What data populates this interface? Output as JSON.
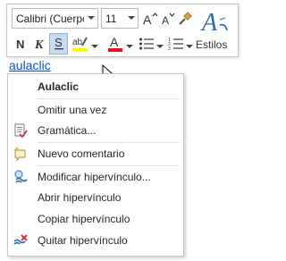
{
  "mini_toolbar": {
    "font_name": "Calibri (Cuerpc",
    "font_size": "11",
    "styles_label": "Estilos",
    "highlight_color": "#ffff00",
    "font_color": "#e81123"
  },
  "document": {
    "link_text": "aulaclic",
    "link_color": "#0b56c4"
  },
  "context_menu": {
    "title": "Aulaclic",
    "items": [
      {
        "label": "Omitir una vez"
      },
      {
        "label": "Gramática..."
      },
      {
        "label": "Nuevo comentario"
      },
      {
        "label": "Modificar hipervínculo..."
      },
      {
        "label": "Abrir hipervínculo"
      },
      {
        "label": "Copiar hipervínculo"
      },
      {
        "label": "Quitar hipervínculo"
      }
    ]
  }
}
